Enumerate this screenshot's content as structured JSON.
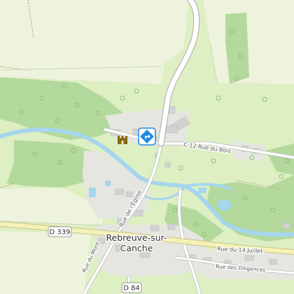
{
  "map": {
    "place_label": [
      "Rebreuve-sur-",
      "Canche"
    ],
    "roads": {
      "d339_ref": "D 339",
      "d84_ref": "D 84",
      "c12_label": "C 12 Rue du Bois",
      "rue_14_juillet": "Rue du 14 Juillet",
      "rue_diligences": "Rue des Diligences",
      "rue_eglise": "Rue de l'Église",
      "rue_mont": "Rue du Mont"
    },
    "pois": [
      {
        "name": "castle",
        "icon": "castle-icon",
        "color": "#8a6a14"
      },
      {
        "name": "selected-marker",
        "icon": "diamond-direction-icon",
        "color": "#1e88e5"
      }
    ],
    "colors": {
      "meadow": "#ddefc3",
      "field": "#eef5dc",
      "forest": "#b6dba0",
      "water": "#a8d8ee",
      "road": "#ffffff",
      "main_road": "#f4f1b6",
      "building": "#d3d3d3",
      "residential": "#e6e6e2"
    }
  }
}
